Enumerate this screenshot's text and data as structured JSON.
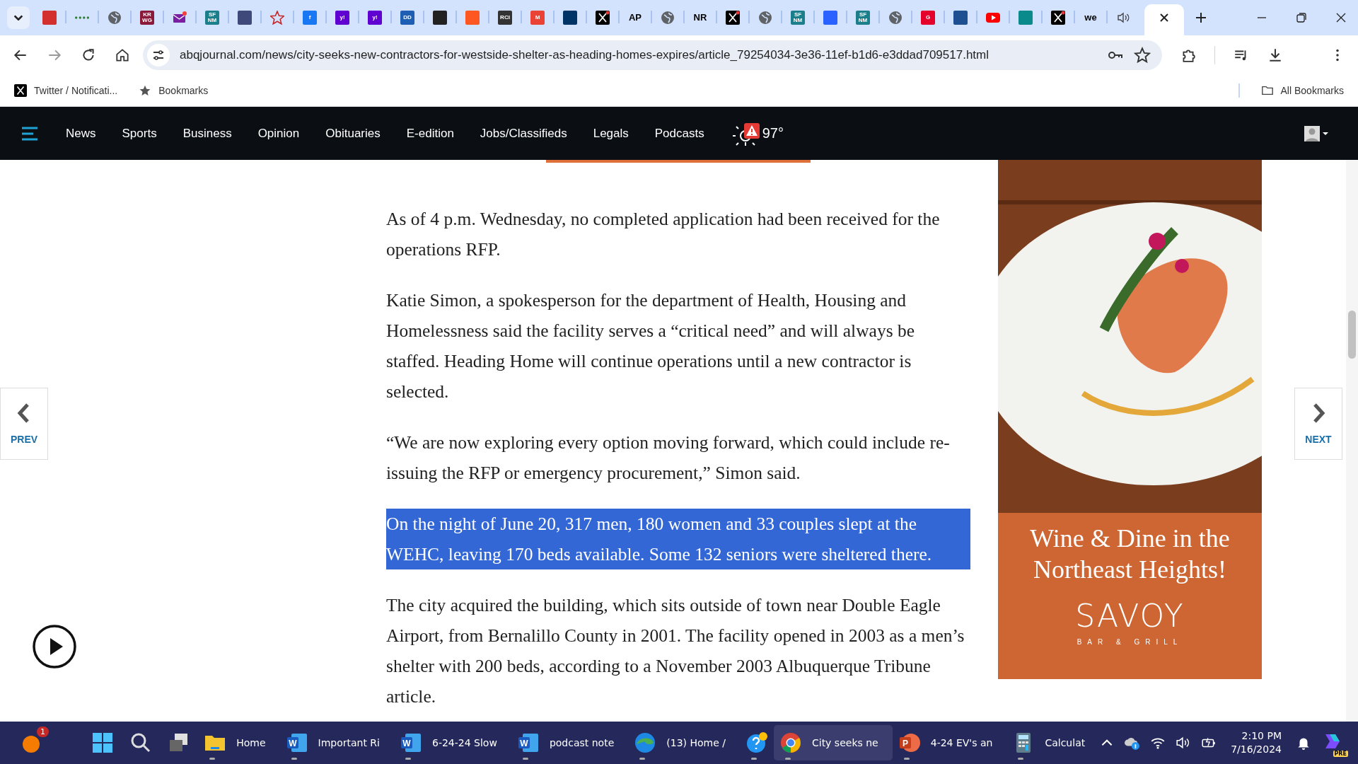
{
  "browser": {
    "tabs": [
      {
        "kind": "mark",
        "color": "#d32f2f",
        "selected": false
      },
      {
        "kind": "dots",
        "color": "#2e7d32",
        "selected": false
      },
      {
        "kind": "globe",
        "selected": false
      },
      {
        "kind": "glyph",
        "glyph": "KR WG",
        "color": "#8b1a3a",
        "selected": false
      },
      {
        "kind": "mail",
        "color": "#7b1fa2",
        "selected": false
      },
      {
        "kind": "glyph",
        "glyph": "SF NM",
        "color": "#1a7f8a",
        "selected": false
      },
      {
        "kind": "mark",
        "color": "#3f4a7a",
        "selected": false
      },
      {
        "kind": "star",
        "color": "#c62828",
        "selected": false
      },
      {
        "kind": "glyph",
        "glyph": "f",
        "color": "#1877f2",
        "selected": false
      },
      {
        "kind": "glyph",
        "glyph": "y!",
        "color": "#6001d2",
        "selected": false
      },
      {
        "kind": "glyph",
        "glyph": "y!",
        "color": "#6001d2",
        "selected": false
      },
      {
        "kind": "glyph",
        "glyph": "DD",
        "color": "#1e5fb4",
        "selected": false
      },
      {
        "kind": "mark",
        "color": "#222222",
        "selected": false
      },
      {
        "kind": "mark",
        "color": "#ff5722",
        "selected": false
      },
      {
        "kind": "glyph",
        "glyph": "RCI",
        "color": "#333333",
        "selected": false
      },
      {
        "kind": "glyph",
        "glyph": "M",
        "color": "#ea4335",
        "selected": false
      },
      {
        "kind": "mark",
        "color": "#003366",
        "selected": false
      },
      {
        "kind": "x",
        "selected": false
      },
      {
        "kind": "wordmark",
        "glyph": "AP",
        "selected": false
      },
      {
        "kind": "globe",
        "selected": false
      },
      {
        "kind": "wordmark",
        "glyph": "NR",
        "selected": false
      },
      {
        "kind": "x",
        "selected": false
      },
      {
        "kind": "globe",
        "selected": false
      },
      {
        "kind": "glyph",
        "glyph": "SF NM",
        "color": "#1a7f8a",
        "selected": false
      },
      {
        "kind": "mark",
        "color": "#2962ff",
        "selected": false
      },
      {
        "kind": "glyph",
        "glyph": "SF NM",
        "color": "#1a7f8a",
        "selected": false
      },
      {
        "kind": "globe",
        "selected": false
      },
      {
        "kind": "glyph",
        "glyph": "G",
        "color": "#e4002b",
        "selected": false
      },
      {
        "kind": "mark",
        "color": "#1d4f91",
        "selected": false
      },
      {
        "kind": "youtube",
        "color": "#ff0000",
        "selected": false
      },
      {
        "kind": "mark",
        "color": "#0a8a8a",
        "selected": false
      },
      {
        "kind": "x",
        "selected": false
      },
      {
        "kind": "wordmark",
        "glyph": "we",
        "selected": false
      },
      {
        "kind": "audio",
        "selected": false
      },
      {
        "kind": "close",
        "selected": true
      }
    ],
    "url": "abqjournal.com/news/city-seeks-new-contractors-for-westside-shelter-as-heading-homes-expires/article_79254034-3e36-11ef-b1d6-e3ddad709517.html",
    "bookmarks": [
      {
        "kind": "x",
        "label": "Twitter / Notificati..."
      },
      {
        "kind": "star",
        "label": "Bookmarks"
      }
    ],
    "all_bookmarks": "All Bookmarks"
  },
  "site_nav": {
    "items": [
      "News",
      "Sports",
      "Business",
      "Opinion",
      "Obituaries",
      "E-edition",
      "Jobs/Classifieds",
      "Legals",
      "Podcasts"
    ],
    "weather": "97°"
  },
  "article": {
    "paragraphs": [
      {
        "text": "As of 4 p.m. Wednesday, no completed application had been received for the operations RFP.",
        "highlighted": false
      },
      {
        "text": "Katie Simon, a spokesperson for the department of Health, Housing and Homelessness said the facility serves a “critical need” and will always be staffed. Heading Home will continue operations until a new contractor is selected.",
        "highlighted": false
      },
      {
        "text": "“We are now exploring every option moving forward, which could include re-issuing the RFP or emergency procurement,” Simon said.",
        "highlighted": false
      },
      {
        "text": "On the night of June 20, 317 men, 180 women and 33 couples slept at the WEHC, leaving 170 beds available. Some 132 seniors were sheltered there.",
        "highlighted": true
      },
      {
        "text": "The city acquired the building, which sits outside of town near Double Eagle Airport, from Bernalillo County in 2001. The facility opened in 2003 as a men’s shelter with 200 beds, according to a November 2003 Albuquerque Tribune article.",
        "highlighted": false
      }
    ]
  },
  "pager": {
    "prev": "PREV",
    "next": "NEXT"
  },
  "ad": {
    "headline": "Wine & Dine in the Northeast Heights!",
    "logo": "SAVOY",
    "tagline": "BAR & GRILL"
  },
  "taskbar": {
    "notification_count": "1",
    "apps": [
      {
        "kind": "folder",
        "label": "Home",
        "selected": false
      },
      {
        "kind": "word",
        "glyph": "W",
        "label": "Important Ri",
        "selected": false
      },
      {
        "kind": "word",
        "glyph": "W",
        "label": "6-24-24 Slow",
        "selected": false
      },
      {
        "kind": "word",
        "glyph": "W",
        "label": "podcast note",
        "selected": false
      },
      {
        "kind": "edge",
        "label": "(13) Home /",
        "selected": false
      },
      {
        "kind": "help",
        "selected": false
      },
      {
        "kind": "chrome",
        "label": "City seeks ne",
        "selected": true
      },
      {
        "kind": "powerpoint",
        "glyph": "P",
        "label": "4-24 EV's an",
        "selected": false
      },
      {
        "kind": "calculator",
        "label": "Calculat",
        "selected": false
      }
    ],
    "time": "2:10 PM",
    "date": "7/16/2024",
    "copilot_badge": "PRE"
  }
}
